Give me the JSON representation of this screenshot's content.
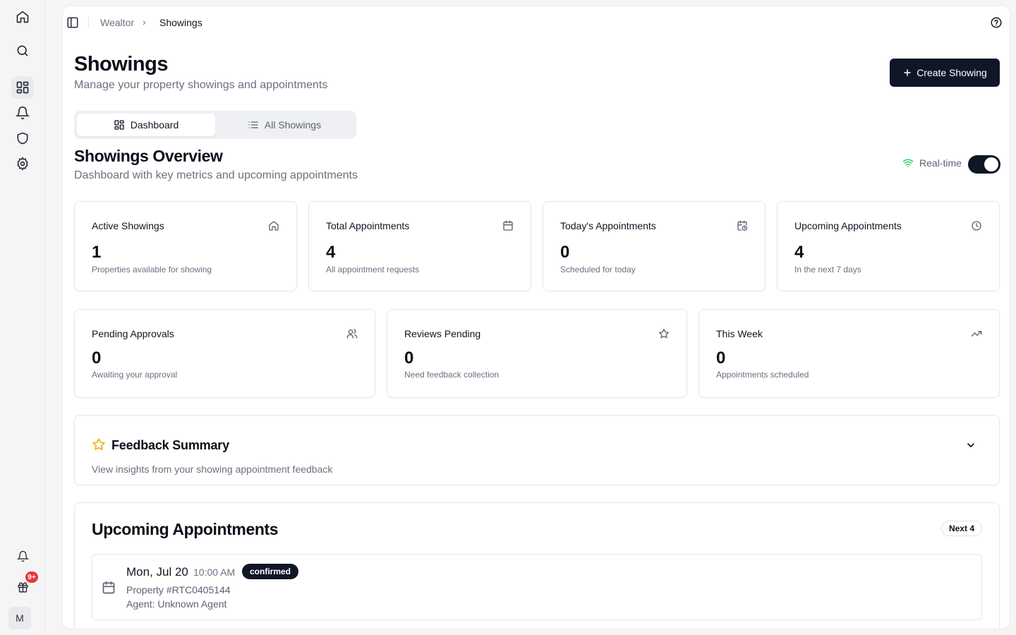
{
  "breadcrumb": {
    "root": "Wealtor",
    "separator": "›",
    "current": "Showings"
  },
  "header": {
    "title": "Showings",
    "subtitle": "Manage your property showings and appointments",
    "create_button_label": "Create Showing"
  },
  "tabs": [
    {
      "label": "Dashboard",
      "icon": "dashboard-icon",
      "active": true
    },
    {
      "label": "All Showings",
      "icon": "list-icon",
      "active": false
    }
  ],
  "overview": {
    "title": "Showings Overview",
    "subtitle": "Dashboard with key metrics and upcoming appointments",
    "realtime_label": "Real-time",
    "realtime_enabled": true
  },
  "metrics_row1": [
    {
      "label": "Active Showings",
      "value": "1",
      "desc": "Properties available for showing",
      "icon": "home-icon"
    },
    {
      "label": "Total Appointments",
      "value": "4",
      "desc": "All appointment requests",
      "icon": "calendar-icon"
    },
    {
      "label": "Today's Appointments",
      "value": "0",
      "desc": "Scheduled for today",
      "icon": "calendar-clock-icon"
    },
    {
      "label": "Upcoming Appointments",
      "value": "4",
      "desc": "In the next 7 days",
      "icon": "clock-icon"
    }
  ],
  "metrics_row2": [
    {
      "label": "Pending Approvals",
      "value": "0",
      "desc": "Awaiting your approval",
      "icon": "users-icon"
    },
    {
      "label": "Reviews Pending",
      "value": "0",
      "desc": "Need feedback collection",
      "icon": "star-icon"
    },
    {
      "label": "This Week",
      "value": "0",
      "desc": "Appointments scheduled",
      "icon": "trending-up-icon"
    }
  ],
  "feedback": {
    "title": "Feedback Summary",
    "description": "View insights from your showing appointment feedback"
  },
  "upcoming": {
    "title": "Upcoming Appointments",
    "badge": "Next 4",
    "items": [
      {
        "date": "Mon, Jul 20",
        "time": "10:00 AM",
        "status": "confirmed",
        "property": "Property #RTC0405144",
        "agent": "Agent: Unknown Agent"
      }
    ]
  },
  "rail": {
    "badge": "9+",
    "avatar_initial": "M"
  },
  "colors": {
    "primary": "#0f1626",
    "accent_star": "#eab308",
    "realtime_green": "#22c55e",
    "badge_red": "#e5383b"
  }
}
